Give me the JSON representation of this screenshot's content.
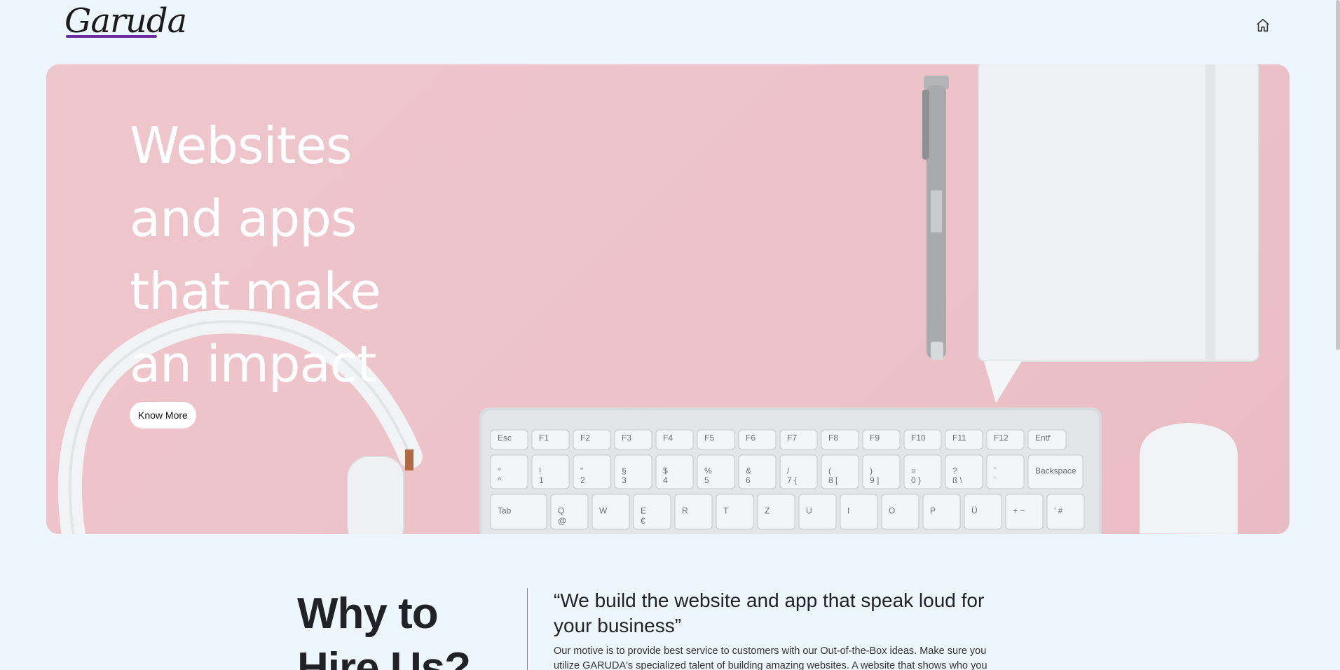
{
  "header": {
    "logo_text": "Garuda",
    "home_icon": "home-icon"
  },
  "hero": {
    "title": "Websites\nand apps\nthat make\nan impact",
    "cta_label": "Know More",
    "keyboard": {
      "fn_row": [
        "Esc",
        "F1",
        "F2",
        "F3",
        "F4",
        "F5",
        "F6",
        "F7",
        "F8",
        "F9",
        "F10",
        "F11",
        "F12",
        "Entf"
      ],
      "num_row_top": [
        "°",
        "!",
        "\"",
        "§",
        "$",
        "%",
        "&",
        "/",
        "(",
        ")",
        "=",
        "?",
        "`"
      ],
      "num_row_bottom": [
        "^",
        "1",
        "2",
        "3",
        "4",
        "5",
        "6",
        "7 {",
        "8 [",
        "9 ]",
        "0 }",
        "ß \\",
        "´"
      ],
      "backspace": "Backspace",
      "tab": "Tab",
      "letter_row": [
        "Q",
        "W",
        "E",
        "R",
        "T",
        "Z",
        "U",
        "I",
        "O",
        "P",
        "Ü",
        "+ ~",
        "' #"
      ],
      "letter_sub": [
        "@",
        "",
        "€",
        "",
        "",
        "",
        "",
        "",
        "",
        "",
        "",
        "",
        ""
      ]
    }
  },
  "why": {
    "heading": "Why to\nHire Us?",
    "quote": "“We build the website and app that speak loud for your business”",
    "body": "Our motive is to provide best service to customers with our Out-of-the-Box ideas. Make sure you utilize GARUDA's specialized talent of building amazing websites. A website that shows who you"
  },
  "colors": {
    "page_bg": "#eef6fd",
    "hero_bg": "#edc3c9",
    "logo_accent": "#6a2ea0"
  }
}
